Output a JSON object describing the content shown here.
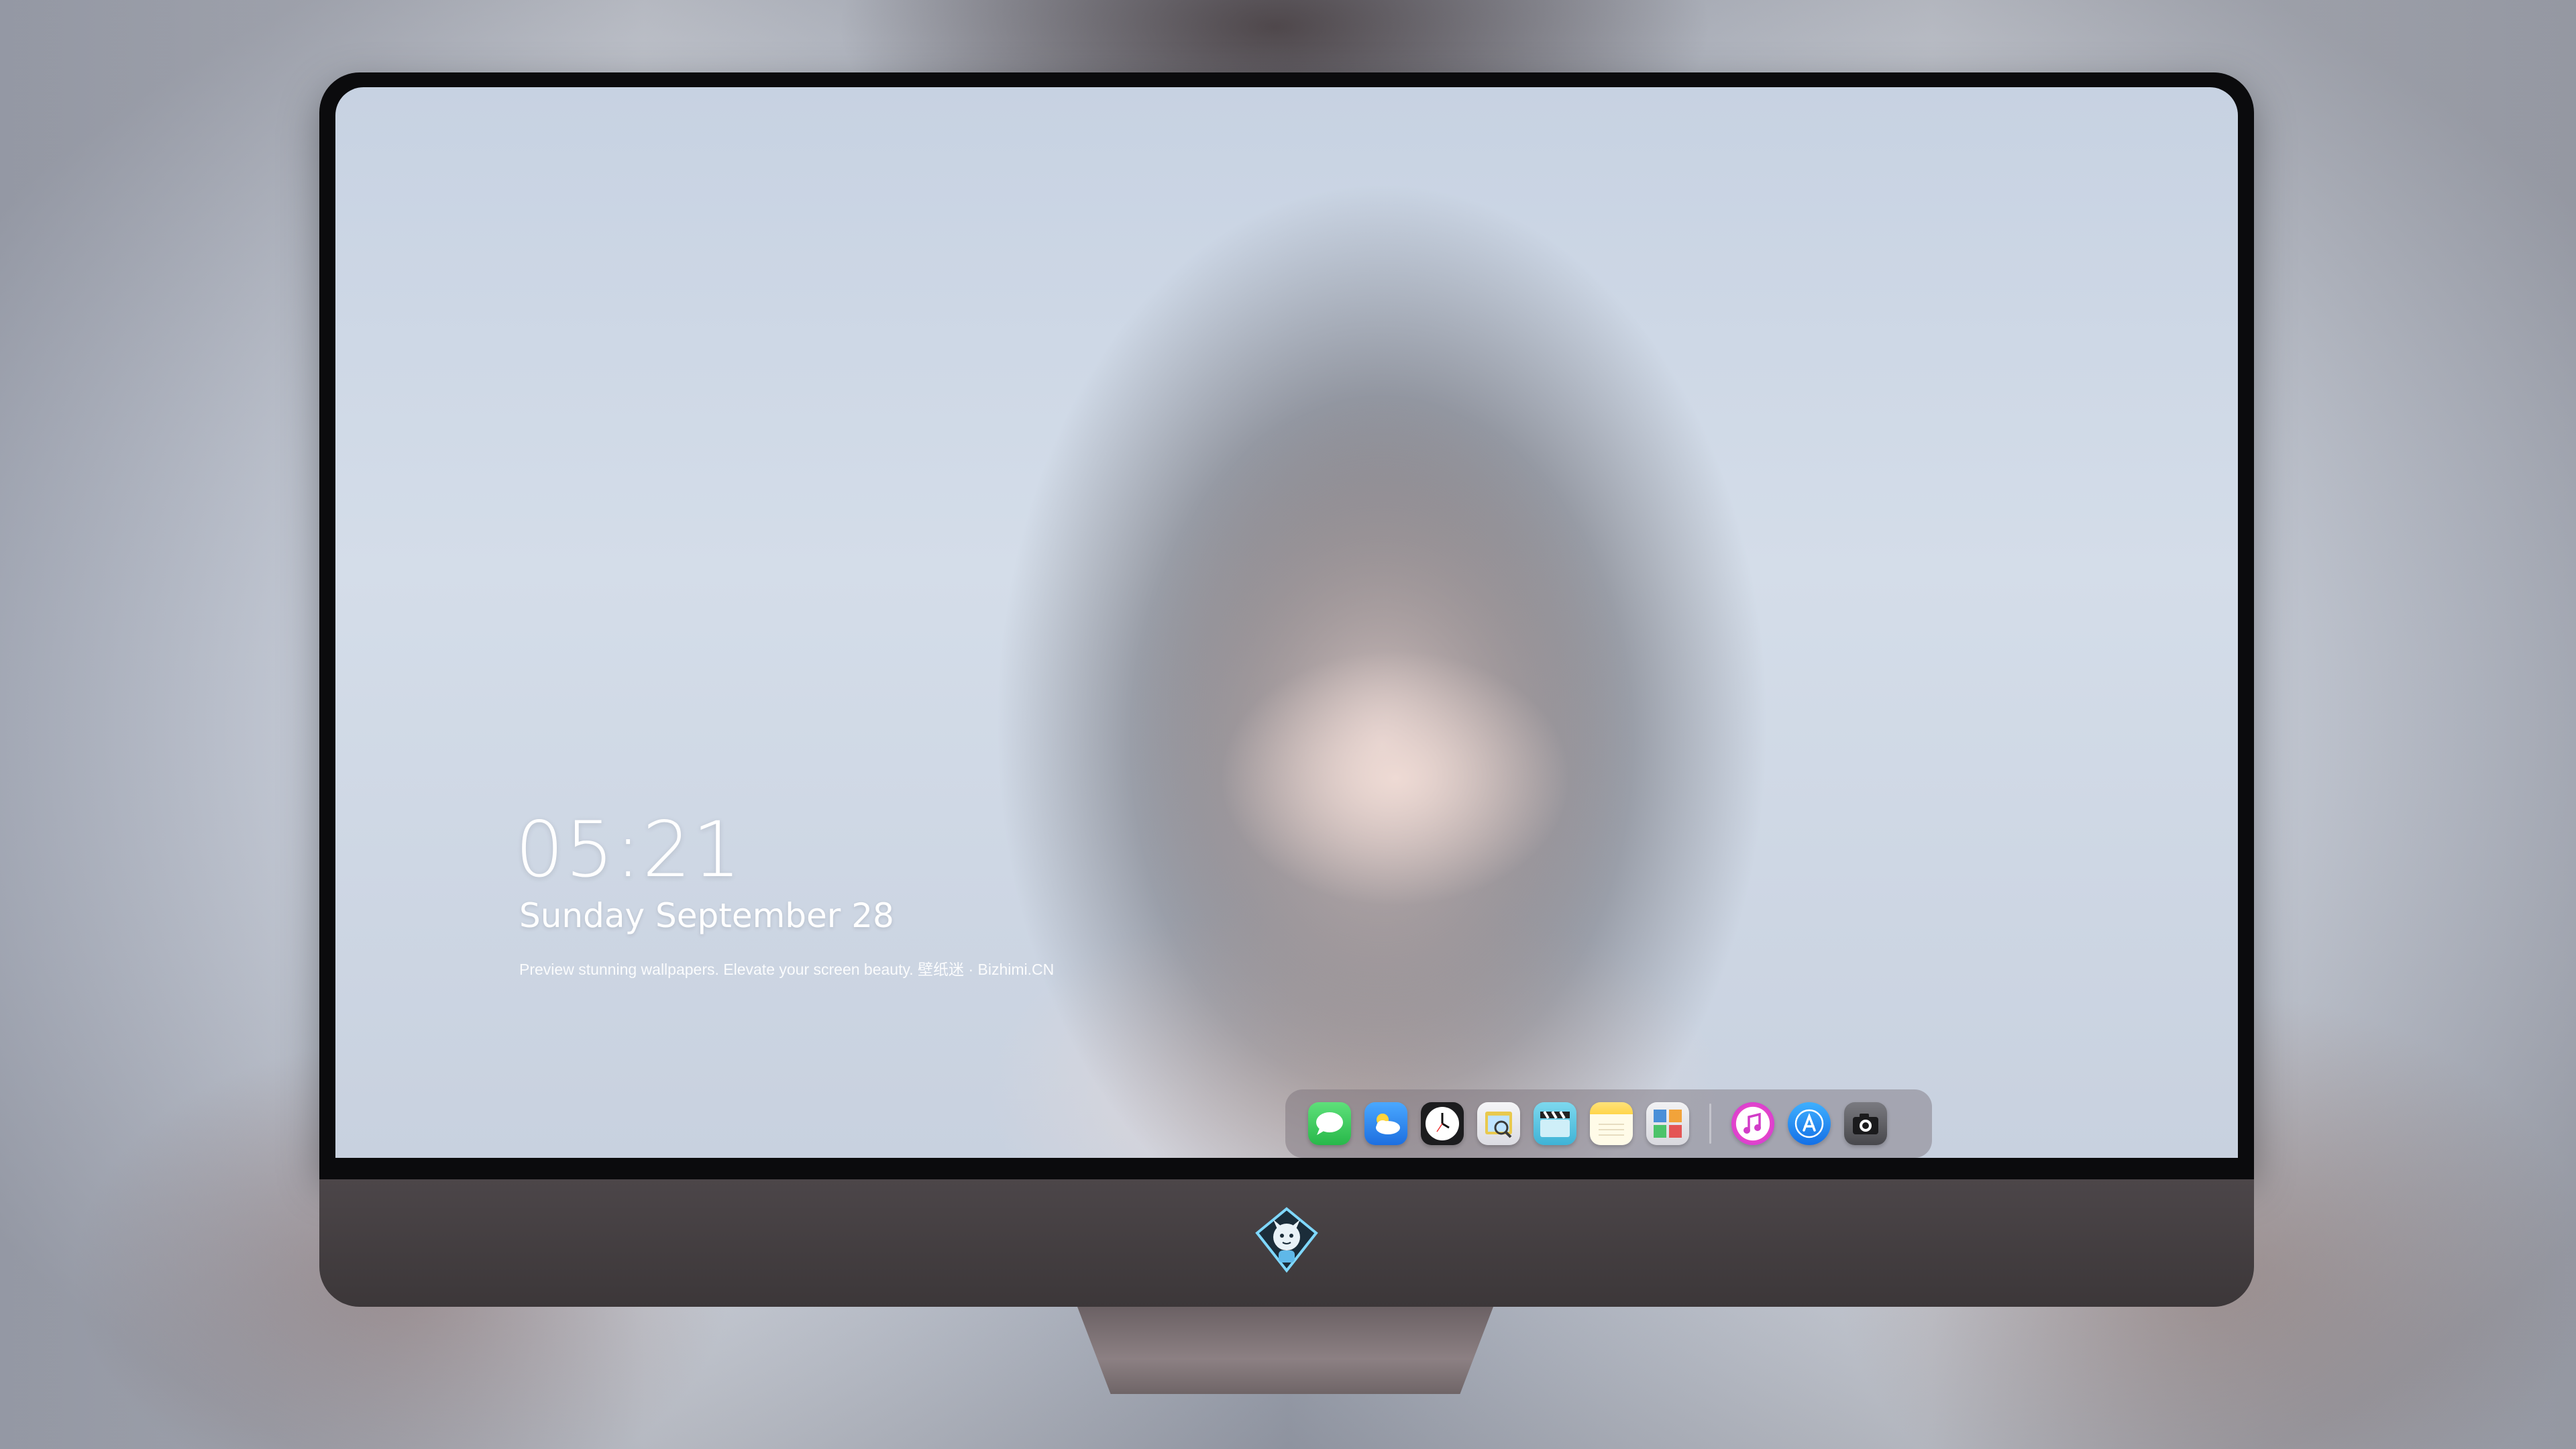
{
  "lockscreen": {
    "time": "05:21",
    "date": "Sunday September  28",
    "tagline": "Preview stunning wallpapers. Elevate your screen beauty. 壁纸迷 · Bizhimi.CN"
  },
  "dock": {
    "apps": [
      {
        "icon": "messages-icon",
        "color": "#34c759"
      },
      {
        "icon": "weather-icon",
        "color": "#2f8cf0"
      },
      {
        "icon": "clock-icon",
        "color": "#1c1c1e"
      },
      {
        "icon": "preview-icon",
        "color": "#e8c84a"
      },
      {
        "icon": "clapper-icon",
        "color": "#5ac8e0"
      },
      {
        "icon": "notes-icon",
        "color": "#ffd54a"
      },
      {
        "icon": "photo-booth-icon",
        "color": "#4a8fd8"
      },
      {
        "icon": "music-icon",
        "color": "#e545c9"
      },
      {
        "icon": "app-store-icon",
        "color": "#1e8ef5"
      },
      {
        "icon": "camera-icon",
        "color": "#5a5a5e"
      }
    ]
  },
  "colors": {
    "bezel": "#0b0b0d",
    "chin": "#443e41",
    "wallpaper_sky": "#cdd6e4"
  }
}
